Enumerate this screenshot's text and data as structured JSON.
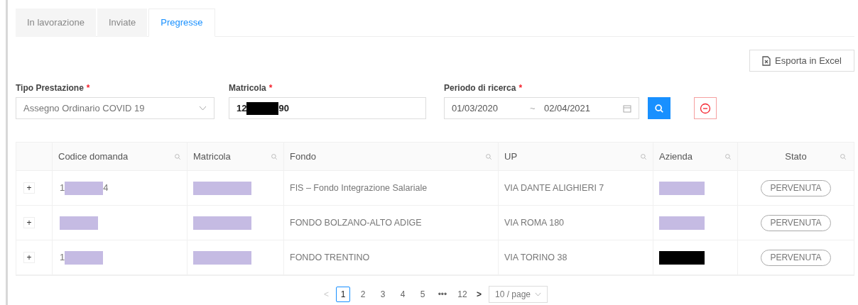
{
  "tabs": [
    {
      "label": "In lavorazione",
      "selected": false
    },
    {
      "label": "Inviate",
      "selected": false
    },
    {
      "label": "Pregresse",
      "selected": true
    }
  ],
  "export_button": "Esporta in Excel",
  "filters": {
    "tipo_prestazione": {
      "label": "Tipo Prestazione",
      "required_mark": "*",
      "value": "Assegno Ordinario COVID 19"
    },
    "matricola": {
      "label": "Matricola",
      "required_mark": "*",
      "value_before": "12",
      "value_after": "90",
      "color": "#000000"
    },
    "periodo": {
      "label": "Periodo di ricerca",
      "required_mark": "*",
      "start": "01/03/2020",
      "separator": "~",
      "end": "02/04/2021"
    }
  },
  "table": {
    "columns": [
      {
        "label": "Codice domanda"
      },
      {
        "label": "Matricola"
      },
      {
        "label": "Fondo"
      },
      {
        "label": "UP"
      },
      {
        "label": "Azienda"
      },
      {
        "label": "Stato"
      }
    ],
    "rows": [
      {
        "expand": "+",
        "codice": {
          "before": "1",
          "after": "4",
          "color": "#c5bbe3"
        },
        "matricola": {
          "color": "#c5bbe3"
        },
        "fondo": "FIS – Fondo Integrazione Salariale",
        "up": "VIA DANTE ALIGHIERI 7",
        "azienda": {
          "color": "#c5bbe3"
        },
        "stato": "PERVENUTA"
      },
      {
        "expand": "+",
        "codice": {
          "color": "#c5bbe3"
        },
        "matricola": {
          "color": "#c5bbe3"
        },
        "fondo": "FONDO BOLZANO-ALTO ADIGE",
        "up": "VIA ROMA 180",
        "azienda": {
          "color": "#c5bbe3"
        },
        "stato": "PERVENUTA"
      },
      {
        "expand": "+",
        "codice": {
          "before": "1",
          "color": "#c5bbe3"
        },
        "matricola": {
          "color": "#c5bbe3"
        },
        "fondo": "FONDO TRENTINO",
        "up": "VIA TORINO 38",
        "azienda": {
          "color": "#000000"
        },
        "stato": "PERVENUTA"
      }
    ]
  },
  "pagination": {
    "prev": "<",
    "pages": [
      {
        "label": "1",
        "selected": true
      },
      {
        "label": "2",
        "selected": false
      },
      {
        "label": "3",
        "selected": false
      },
      {
        "label": "4",
        "selected": false
      },
      {
        "label": "5",
        "selected": false
      },
      {
        "label": "•••",
        "selected": false
      },
      {
        "label": "12",
        "selected": false
      }
    ],
    "next": ">",
    "page_size": "10 / page"
  }
}
